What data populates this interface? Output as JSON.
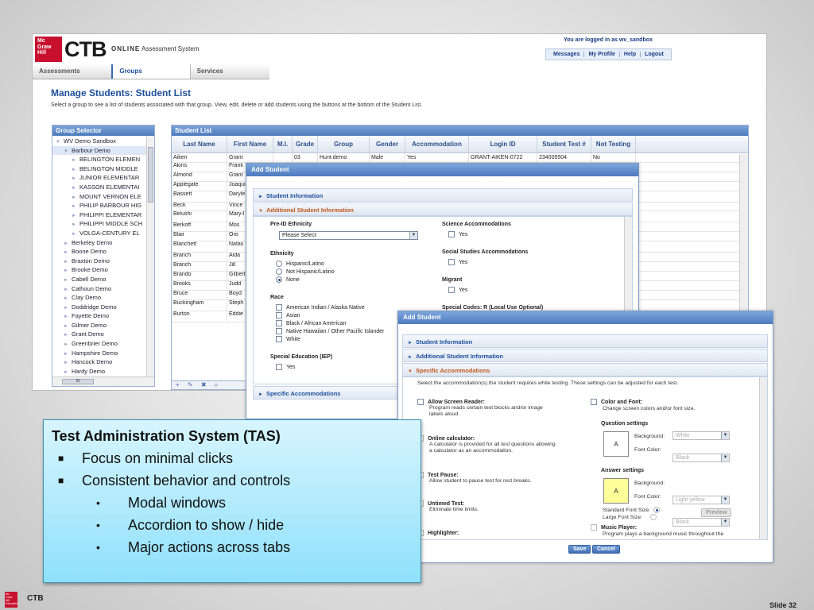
{
  "app": {
    "logo_text": [
      "Mc",
      "Graw",
      "Hill"
    ],
    "logo_ctb": "CTB",
    "title_bold": "ONLINE",
    "title_rest": "Assessment System",
    "logged_in": "You are logged in as wv_sandbox",
    "top_links": [
      "Messages",
      "My Profile",
      "Help",
      "Logout"
    ],
    "nav_tabs": [
      "Assessments",
      "Groups",
      "Services"
    ],
    "active_tab": 1,
    "page_title": "Manage Students: Student List",
    "page_subtitle": "Select a group to see a list of students associated with that group. View, edit, delete or add students using the buttons at the bottom of the Student List."
  },
  "group_selector": {
    "title": "Group Selector",
    "items": [
      {
        "label": "WV Demo Sandbox",
        "level": 0
      },
      {
        "label": "Barbour Demo",
        "level": 1,
        "selected": true
      },
      {
        "label": "BELINGTON ELEMEN",
        "level": 2
      },
      {
        "label": "BELINGTON MIDDLE",
        "level": 2
      },
      {
        "label": "JUNIOR ELEMENTAR",
        "level": 2
      },
      {
        "label": "KASSON ELEMENTAI",
        "level": 2
      },
      {
        "label": "MOUNT VERNON ELE",
        "level": 2
      },
      {
        "label": "PHILIP BARBOUR HIG",
        "level": 2
      },
      {
        "label": "PHILIPPI ELEMENTAR",
        "level": 2
      },
      {
        "label": "PHILIPPI MIDDLE SCH",
        "level": 2
      },
      {
        "label": "VOLGA-CENTURY EL",
        "level": 2
      },
      {
        "label": "Berkeley Demo",
        "level": 1
      },
      {
        "label": "Boone Demo",
        "level": 1
      },
      {
        "label": "Braxton Demo",
        "level": 1
      },
      {
        "label": "Brooke Demo",
        "level": 1
      },
      {
        "label": "Cabell Demo",
        "level": 1
      },
      {
        "label": "Calhoun Demo",
        "level": 1
      },
      {
        "label": "Clay Demo",
        "level": 1
      },
      {
        "label": "Doddridge Demo",
        "level": 1
      },
      {
        "label": "Fayette Demo",
        "level": 1
      },
      {
        "label": "Gilmer Demo",
        "level": 1
      },
      {
        "label": "Grant Demo",
        "level": 1
      },
      {
        "label": "Greenbrier Demo",
        "level": 1
      },
      {
        "label": "Hampshire Demo",
        "level": 1
      },
      {
        "label": "Hancock Demo",
        "level": 1
      },
      {
        "label": "Hardy Demo",
        "level": 1
      }
    ],
    "hscroll_label": "III"
  },
  "student_list": {
    "title": "Student List",
    "columns": [
      "Last Name",
      "First Name",
      "M.I.",
      "Grade",
      "Group",
      "Gender",
      "Accommodation",
      "Login ID",
      "Student Test #",
      "Not Testing"
    ],
    "first_row": [
      "Aiken",
      "Grant",
      "",
      "03",
      "Hunt demo",
      "Male",
      "Yes",
      "GRANT-AIKEN-0722",
      "234005504",
      "No"
    ],
    "rows": [
      [
        "Aiken",
        "Grant"
      ],
      [
        "Akins",
        "Frank"
      ],
      [
        "Almond",
        "Grant"
      ],
      [
        "Applegate",
        "Joaqui"
      ],
      [
        "Bassett",
        "Daryle"
      ],
      [
        "Beck",
        "Vince"
      ],
      [
        "Belushi",
        "Mary-l"
      ],
      [
        "Berkoff",
        "Mos"
      ],
      [
        "Blair",
        "Oro"
      ],
      [
        "Blanchett",
        "Natas"
      ],
      [
        "Branch",
        "Aida"
      ],
      [
        "Branch",
        "Jill"
      ],
      [
        "Brando",
        "Gilbert"
      ],
      [
        "Brooks",
        "Judd"
      ],
      [
        "Bruce",
        "Boyd"
      ],
      [
        "Buckingham",
        "Steph"
      ],
      [
        "Burton",
        "Eddie"
      ]
    ]
  },
  "modal1": {
    "title": "Add Student",
    "acc_student": "Student Information",
    "acc_additional": "Additional Student Information",
    "preid_label": "Pre-ID Ethnicity",
    "preid_value": "Please Select",
    "ethnicity_label": "Ethnicity",
    "ethnicity_options": [
      "Hispanic/Latino",
      "Not Hispanic/Latino",
      "None"
    ],
    "ethnicity_selected": 2,
    "race_label": "Race",
    "race_options": [
      "American Indian / Alaska Native",
      "Asian",
      "Black / African American",
      "Native Hawaiian / Other Pacific Islander",
      "White"
    ],
    "sped_label": "Special Education (IEP)",
    "yes": "Yes",
    "science_label": "Science Accommodations",
    "social_label": "Social Studies Accommodations",
    "migrant_label": "Migrant",
    "special_codes_label": "Special Codes: R (Local Use Optional)",
    "acc_specific": "Specific Accommodations"
  },
  "modal2": {
    "title": "Add Student",
    "acc_student": "Student Information",
    "acc_additional": "Additional Student Information",
    "acc_specific": "Specific Accommodations",
    "intro": "Select the accommodation(s) the student requires while testing. These settings can be adjusted for each test.",
    "left_items": [
      {
        "title": "Allow Screen Reader:",
        "desc": [
          "Program reads certain text blocks and/or image",
          "labels aloud."
        ],
        "checked": false
      },
      {
        "title": "Online calculator:",
        "desc": [
          "A calculator is provided for all test questions allowing",
          "a calculator as an accommodation."
        ],
        "checked": true
      },
      {
        "title": "Test Pause:",
        "desc": [
          "Allow student to pause test for rest breaks."
        ],
        "checked": true
      },
      {
        "title": "Untimed Test:",
        "desc": [
          "Eliminate time limits."
        ],
        "checked": true
      },
      {
        "title": "Highlighter:",
        "desc": [],
        "checked": true
      }
    ],
    "color_font_label": "Color and Font:",
    "color_font_desc": "Change screen colors and/or font size.",
    "question_settings": "Question settings",
    "answer_settings": "Answer settings",
    "swatch_letter": "A",
    "background_label": "Background:",
    "font_color_label": "Font Color:",
    "q_background": "White",
    "q_font": "Black",
    "a_background": "Light yellow",
    "a_font": "Black",
    "std_font": "Standard Font Size:",
    "large_font": "Large Font Size:",
    "preview": "Preview",
    "music_label": "Music Player:",
    "music_desc": "Program plays a background music throughout the",
    "save": "Save",
    "cancel": "Cancel",
    "colors": {
      "q_swatch": "#ffffff",
      "a_swatch": "#ffff99"
    }
  },
  "tas": {
    "title": "Test Administration System (TAS)",
    "bullets": [
      {
        "text": "Focus on minimal clicks",
        "level": 1
      },
      {
        "text": "Consistent behavior and controls",
        "level": 1
      },
      {
        "text": "Modal windows",
        "level": 2
      },
      {
        "text": "Accordion to show / hide",
        "level": 2
      },
      {
        "text": "Major actions across tabs",
        "level": 2
      }
    ]
  },
  "footer": {
    "logo_text": [
      "Mc",
      "Graw",
      "Hill",
      "Education"
    ],
    "ctb": "CTB",
    "slide": "Slide 32"
  }
}
